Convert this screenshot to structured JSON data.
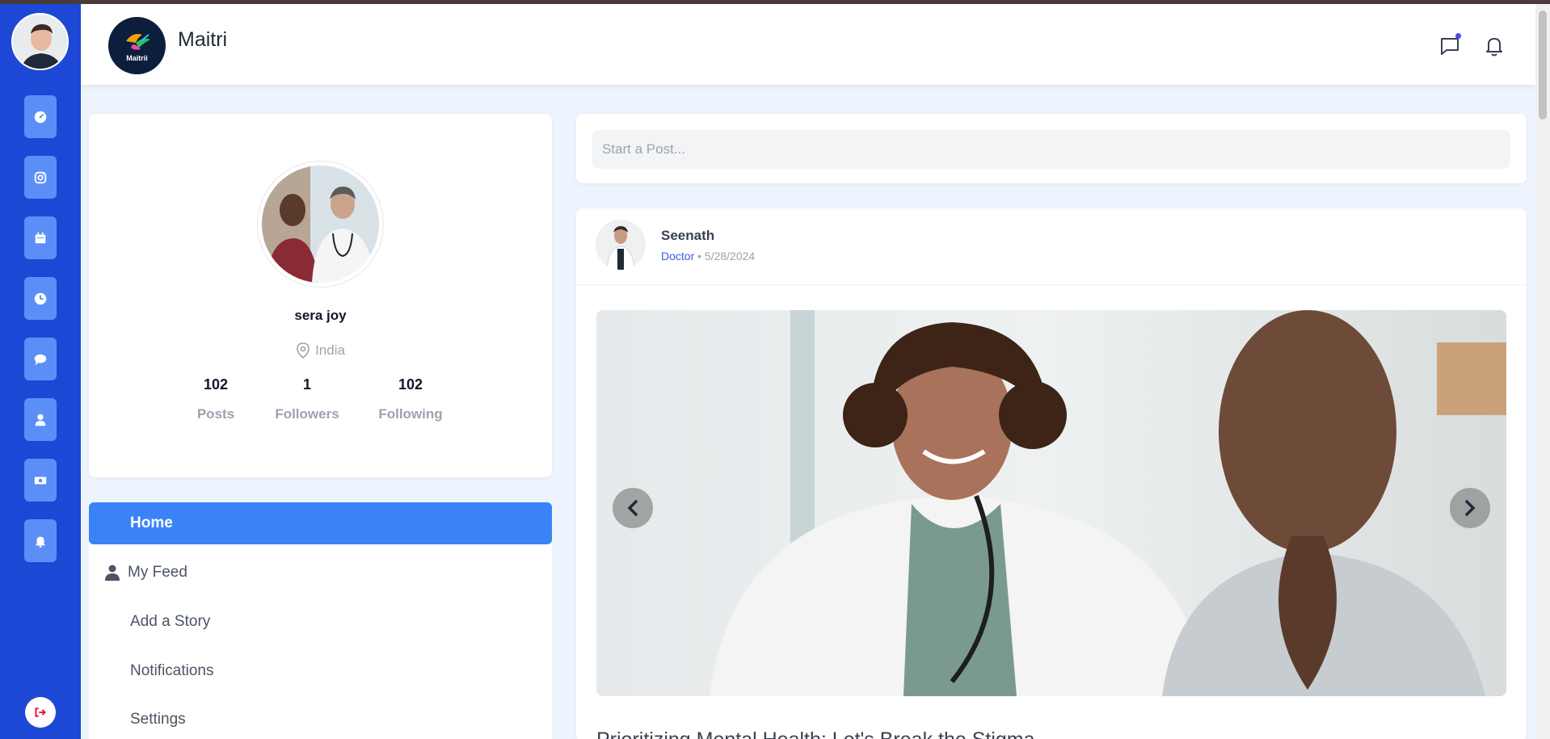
{
  "app": {
    "title": "Maitri",
    "logo_text": "Maitrii"
  },
  "composer": {
    "placeholder": "Start a Post..."
  },
  "profile": {
    "name": "sera joy",
    "location": "India",
    "stats": [
      {
        "value": "102",
        "label": "Posts"
      },
      {
        "value": "1",
        "label": "Followers"
      },
      {
        "value": "102",
        "label": "Following"
      }
    ]
  },
  "nav": {
    "items": [
      {
        "label": "Home",
        "active": true
      },
      {
        "label": "My Feed",
        "icon": "user-icon"
      },
      {
        "label": "Add a Story"
      },
      {
        "label": "Notifications"
      },
      {
        "label": "Settings"
      }
    ]
  },
  "rail": {
    "icons": [
      "dashboard-icon",
      "instagram-icon",
      "calendar-icon",
      "clock-icon",
      "chat-icon",
      "user-icon",
      "money-icon",
      "bell-icon"
    ],
    "logout_icon": "logout-icon"
  },
  "header_icons": [
    "message-icon",
    "bell-icon"
  ],
  "post": {
    "author": "Seenath",
    "role": "Doctor",
    "separator": "•",
    "date": "5/28/2024",
    "title": "Prioritizing Mental Health: Let's Break the Stigma"
  },
  "colors": {
    "rail": "#1d48d6",
    "rail_button": "#5b8ff7",
    "active_nav": "#3b82f6",
    "notification_dot": "#4f46e5",
    "logout": "#e11d48"
  }
}
